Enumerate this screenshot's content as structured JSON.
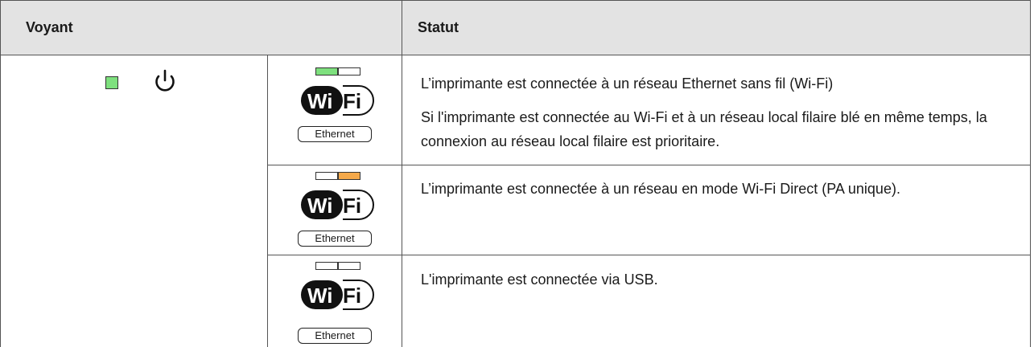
{
  "table": {
    "header": {
      "col_voyant": "Voyant",
      "col_statut": "Statut"
    },
    "rows": [
      {
        "led": {
          "left": "green",
          "right": "off"
        },
        "wifi_label": {
          "wi": "Wi",
          "fi": "Fi"
        },
        "ethernet_label": "Ethernet",
        "status_lines": [
          "L’imprimante est connectée à un réseau Ethernet sans fil (Wi-Fi)",
          "Si l'imprimante est connectée au Wi-Fi et à un réseau local filaire blé en même temps, la connexion au réseau local filaire est prioritaire."
        ]
      },
      {
        "led": {
          "left": "off",
          "right": "orange"
        },
        "wifi_label": {
          "wi": "Wi",
          "fi": "Fi"
        },
        "ethernet_label": "Ethernet",
        "status_lines": [
          "L’imprimante est connectée à un réseau en mode Wi-Fi Direct (PA unique)."
        ]
      },
      {
        "led": {
          "left": "off",
          "right": "off"
        },
        "wifi_label": {
          "wi": "Wi",
          "fi": "Fi"
        },
        "ethernet_label": "Ethernet",
        "status_lines": [
          "L'imprimante est connectée via USB."
        ]
      }
    ],
    "power_led": {
      "color": "green",
      "icon": "power-icon"
    }
  },
  "colors": {
    "green": "#7ee07e",
    "orange": "#f5a94a",
    "off": "#ffffff",
    "header_bg": "#e3e3e3"
  }
}
